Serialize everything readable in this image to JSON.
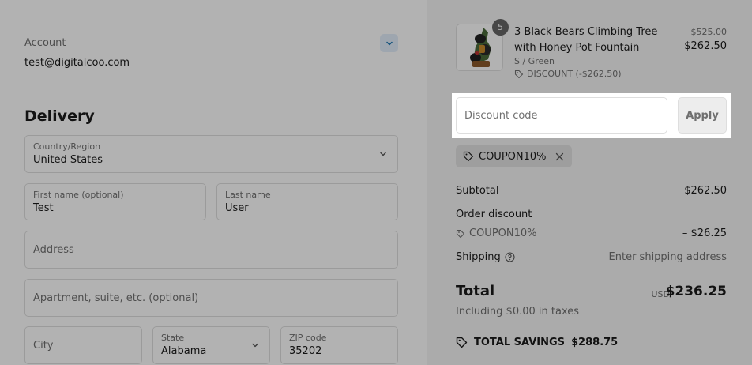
{
  "account": {
    "label": "Account",
    "email": "test@digitalcoo.com"
  },
  "delivery": {
    "title": "Delivery",
    "country": {
      "label": "Country/Region",
      "value": "United States"
    },
    "first_name": {
      "label": "First name (optional)",
      "value": "Test"
    },
    "last_name": {
      "label": "Last name",
      "value": "User"
    },
    "address": {
      "placeholder": "Address"
    },
    "apartment": {
      "placeholder": "Apartment, suite, etc. (optional)"
    },
    "city": {
      "placeholder": "City"
    },
    "state": {
      "label": "State",
      "value": "Alabama"
    },
    "zip": {
      "label": "ZIP code",
      "value": "35202"
    }
  },
  "product": {
    "quantity": "5",
    "name": "3 Black Bears Climbing Tree with Honey Pot Fountain",
    "variant": "S / Green",
    "discount": "DISCOUNT (-$262.50)",
    "original_price": "$525.00",
    "price": "$262.50"
  },
  "discount_code": {
    "placeholder": "Discount code",
    "apply_label": "Apply"
  },
  "applied_coupon": "COUPON10%",
  "summary": {
    "subtotal_label": "Subtotal",
    "subtotal_value": "$262.50",
    "order_discount_label": "Order discount",
    "order_discount_code": "COUPON10%",
    "order_discount_value": "– $26.25",
    "shipping_label": "Shipping",
    "shipping_value": "Enter shipping address",
    "total_label": "Total",
    "currency": "USD",
    "total_value": "$236.25",
    "tax_note": "Including $0.00 in taxes",
    "savings_label": "TOTAL SAVINGS",
    "savings_value": "$288.75"
  }
}
